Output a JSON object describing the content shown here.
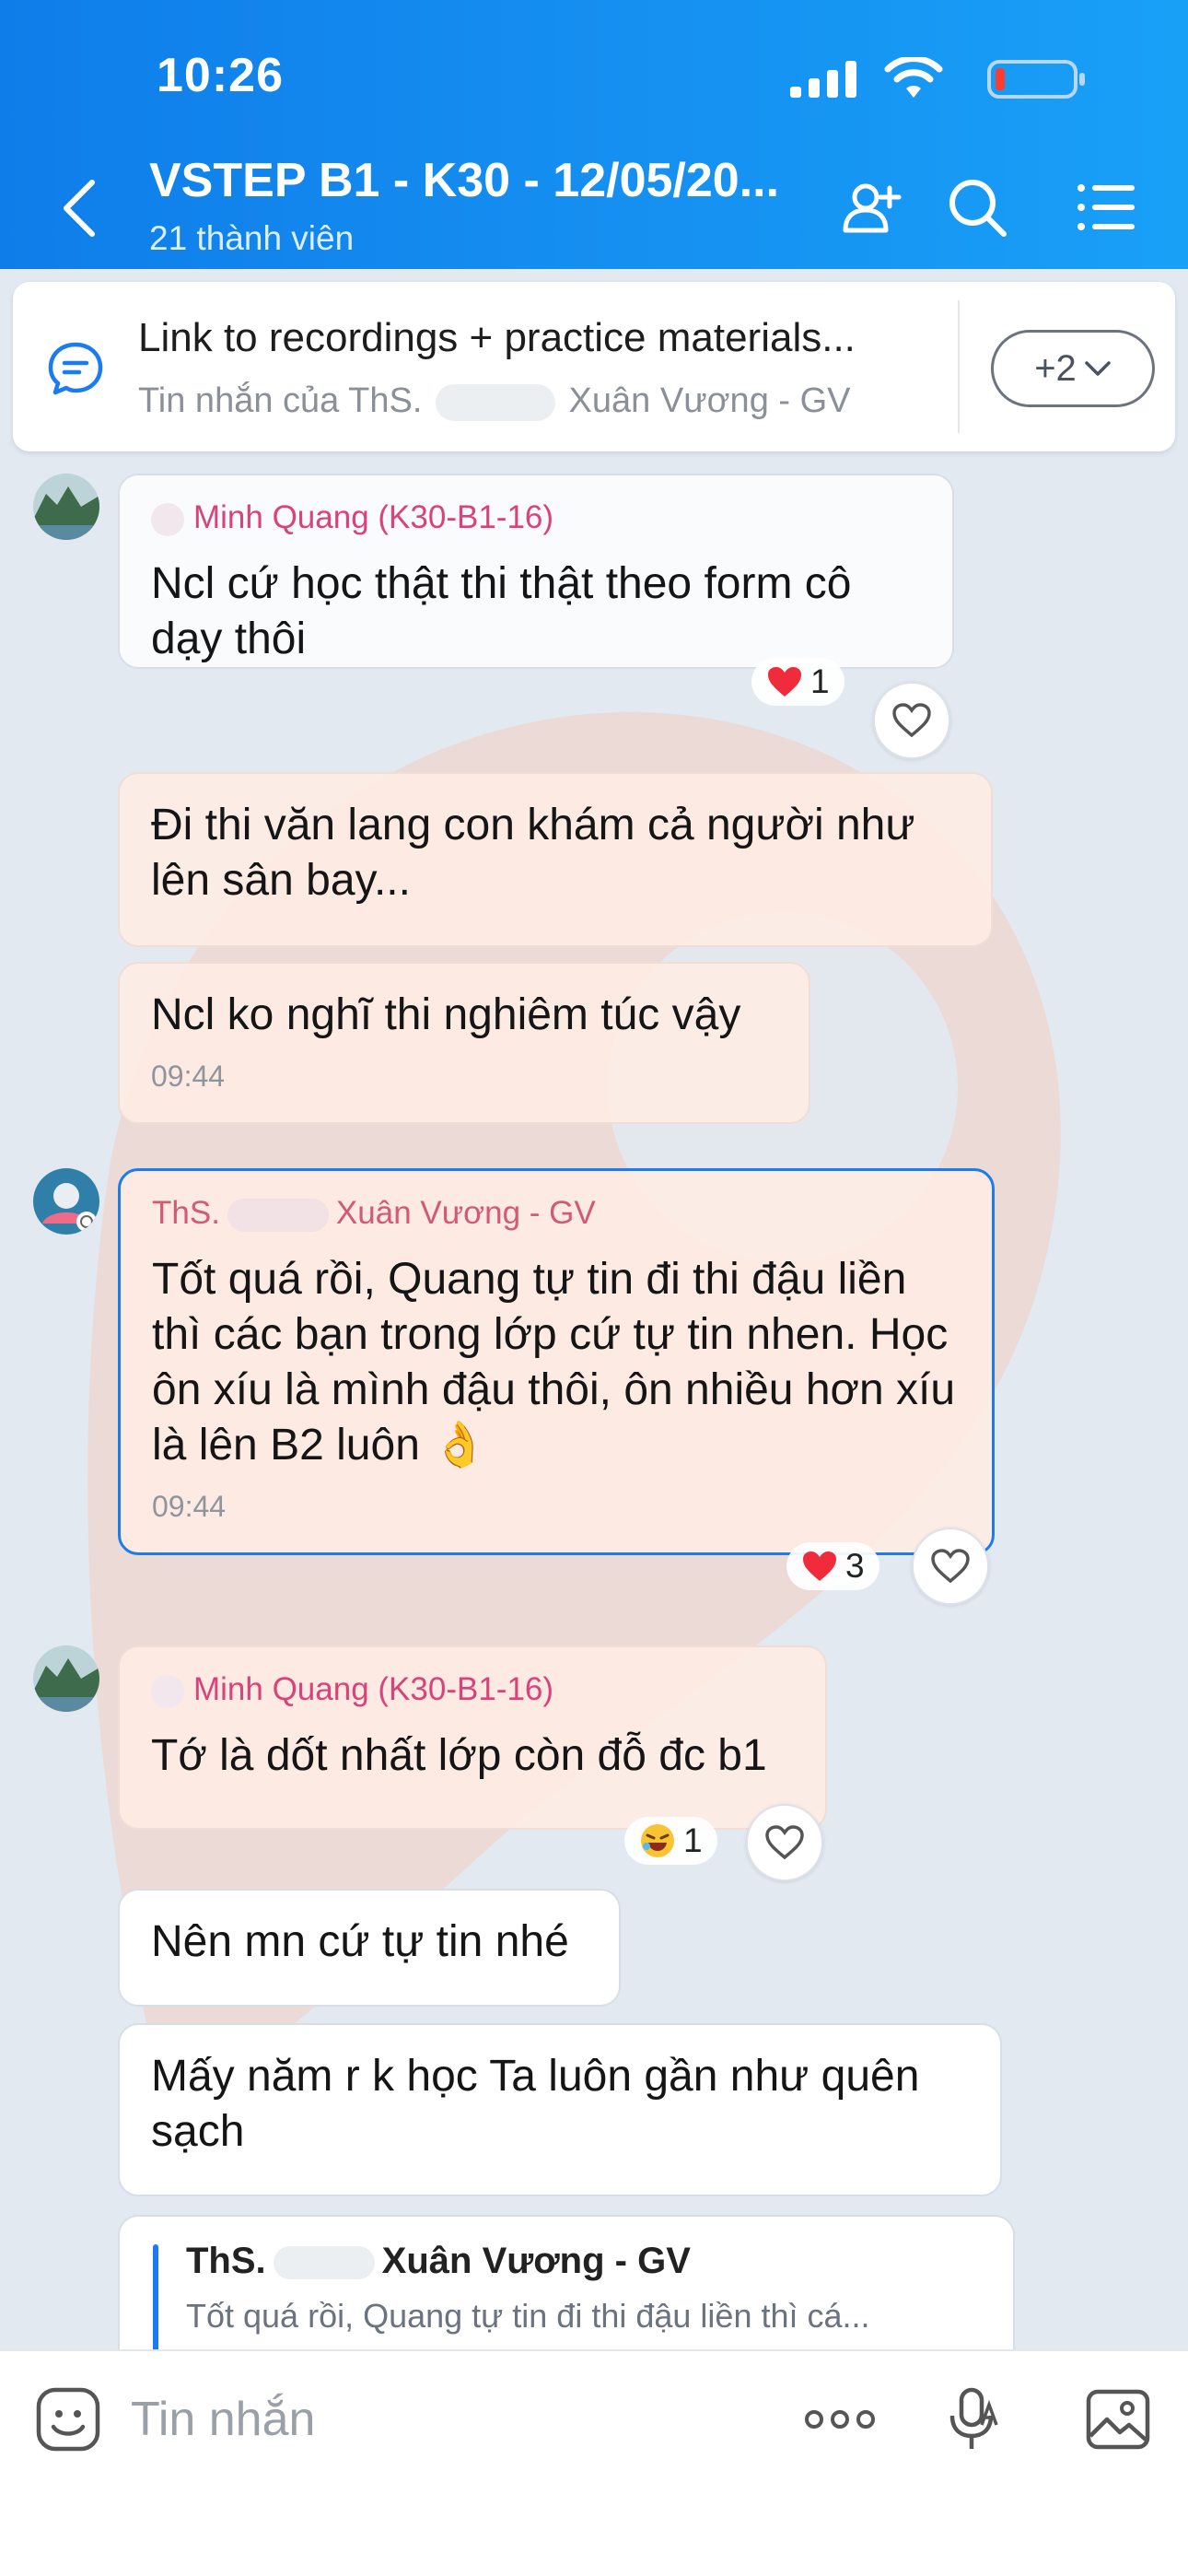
{
  "status_bar": {
    "time": "10:26"
  },
  "header": {
    "title": "VSTEP B1 - K30 - 12/05/20...",
    "subtitle": "21 thành viên"
  },
  "pinned": {
    "title": "Link to recordings + practice materials...",
    "sub_prefix": "Tin nhắn của ThS.",
    "sub_suffix": "Xuân Vương - GV",
    "more_label": "+2"
  },
  "messages": [
    {
      "sender": "Minh Quang (K30-B1-16)",
      "text": "Ncl cứ học thật thi thật theo form cô dạy thôi",
      "reaction": "1"
    },
    {
      "text": "Đi thi văn lang con khám cả người như lên sân bay..."
    },
    {
      "text": "Ncl ko nghĩ thi nghiêm túc vậy",
      "time": "09:44"
    },
    {
      "sender_prefix": "ThS.",
      "sender_suffix": "Xuân Vương - GV",
      "text": "Tốt quá rồi, Quang tự tin đi thi đậu liền thì các bạn trong lớp cứ tự tin nhen. Học ôn xíu là mình đậu thôi, ôn nhiều hơn xíu là lên B2 luôn 👌",
      "time": "09:44",
      "reaction": "3"
    },
    {
      "sender": "Minh Quang (K30-B1-16)",
      "text": "Tớ là dốt nhất lớp còn đỗ đc b1",
      "reaction": "1"
    },
    {
      "text": "Nên mn cứ tự tin nhé"
    },
    {
      "text": "Mấy năm r k học Ta luôn gần như quên sạch"
    },
    {
      "reply_prefix": "ThS.",
      "reply_suffix": "Xuân Vương - GV",
      "reply_text": "Tốt quá rồi, Quang tự tin đi thi đậu liền thì cá..."
    }
  ],
  "input": {
    "placeholder": "Tin nhắn"
  },
  "colors": {
    "header": "#1692f2",
    "accent": "#1a7cf0",
    "sender": "#d9437a"
  }
}
